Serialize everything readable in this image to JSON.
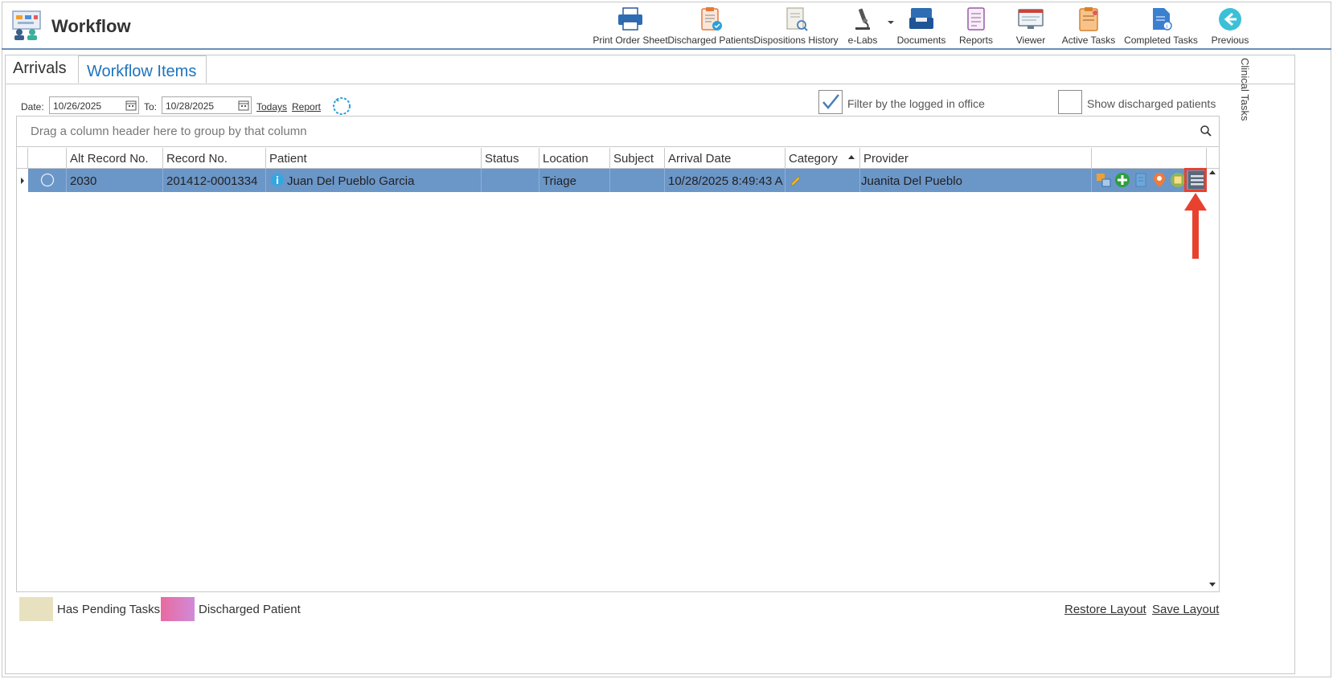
{
  "app": {
    "title": "Workflow"
  },
  "toolbar": {
    "print_order_sheet": "Print Order Sheet",
    "discharged_patients": "Discharged Patients",
    "dispositions_history": "Dispositions History",
    "elabs": "e-Labs",
    "documents": "Documents",
    "reports": "Reports",
    "viewer": "Viewer",
    "active_tasks": "Active Tasks",
    "completed_tasks": "Completed Tasks",
    "previous": "Previous"
  },
  "tabs": {
    "arrivals": "Arrivals",
    "workflow_items": "Workflow Items"
  },
  "filters": {
    "date_label": "Date:",
    "date_from": "10/26/2025",
    "to_label": "To:",
    "date_to": "10/28/2025",
    "todays": "Todays",
    "report": "Report",
    "filter_logged_office": "Filter by the logged in office",
    "filter_logged_office_checked": true,
    "show_discharged": "Show discharged patients",
    "show_discharged_checked": false
  },
  "grid": {
    "group_panel_text": "Drag a column header here to group by that column",
    "columns": [
      "",
      "Alt Record No.",
      "Record No.",
      "Patient",
      "Status",
      "Location",
      "Subject",
      "Arrival Date",
      "Category",
      "Provider",
      ""
    ],
    "sorted_column": "Category",
    "rows": [
      {
        "alt_record_no": "2030",
        "record_no": "201412-0001334",
        "patient": "Juan Del Pueblo Garcia",
        "status": "",
        "location": "Triage",
        "subject": "",
        "arrival_date": "10/28/2025 8:49:43 A",
        "category": "",
        "provider": "Juanita Del Pueblo",
        "actions": [
          "transfer-icon",
          "add-icon",
          "document-icon",
          "location-pin-icon",
          "note-icon",
          "menu-icon"
        ]
      }
    ]
  },
  "legend": {
    "pending_tasks": "Has Pending Tasks",
    "pending_color": "#e8e1c0",
    "discharged": "Discharged Patient",
    "discharged_color": "#e96aa0"
  },
  "layout_links": {
    "restore": "Restore Layout",
    "save": "Save Layout"
  },
  "side_panel": {
    "clinical_tasks": "Clinical Tasks"
  },
  "colors": {
    "selected_row": "#6b96c8",
    "accent": "#1e73be",
    "annotation": "#e8412f"
  }
}
